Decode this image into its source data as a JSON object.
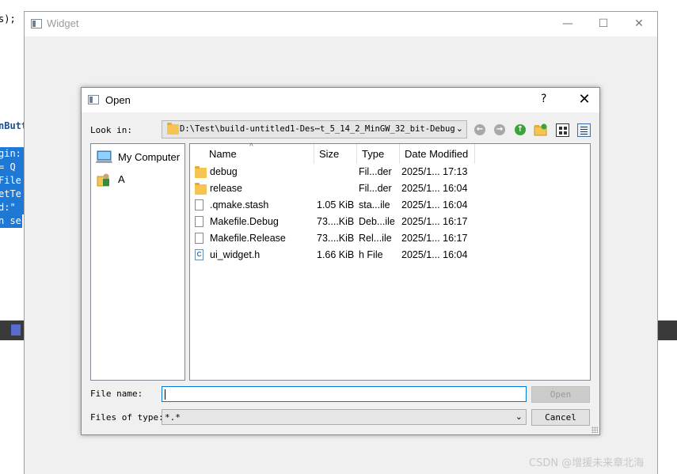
{
  "ide": {
    "lines": [
      "s);",
      "nButt",
      "gin:",
      " = Q",
      "File",
      "etTe",
      "d:\"",
      "n se"
    ]
  },
  "widget": {
    "title": "Widget",
    "minimize": "—",
    "maximize": "☐",
    "close": "✕"
  },
  "dialog": {
    "title": "Open",
    "help": "?",
    "close": "✕",
    "look_in_label": "Look in:",
    "look_in_path": "D:\\Test\\build-untitled1-Des⋯t_5_14_2_MinGW_32_bit-Debug",
    "sidebar": [
      {
        "label": "My Computer"
      },
      {
        "label": "A"
      }
    ],
    "columns": [
      "Name",
      "Size",
      "Type",
      "Date Modified"
    ],
    "files": [
      {
        "name": "debug",
        "size": "",
        "type": "Fil...der",
        "date": "2025/1... 17:13",
        "icon": "folder-icon"
      },
      {
        "name": "release",
        "size": "",
        "type": "Fil...der",
        "date": "2025/1... 16:04",
        "icon": "folder-icon"
      },
      {
        "name": ".qmake.stash",
        "size": "1.05 KiB",
        "type": "sta...ile",
        "date": "2025/1... 16:04",
        "icon": "file-icon"
      },
      {
        "name": "Makefile.Debug",
        "size": "73....KiB",
        "type": "Deb...ile",
        "date": "2025/1... 16:17",
        "icon": "file-icon"
      },
      {
        "name": "Makefile.Release",
        "size": "73....KiB",
        "type": "Rel...ile",
        "date": "2025/1... 16:17",
        "icon": "file-icon"
      },
      {
        "name": "ui_widget.h",
        "size": "1.66 KiB",
        "type": "h File",
        "date": "2025/1... 16:04",
        "icon": "c-header-icon"
      }
    ],
    "file_name_label": "File name:",
    "file_name_value": "",
    "open_button": "Open",
    "file_type_label": "Files of type:",
    "file_type_value": "*.*",
    "cancel_button": "Cancel"
  },
  "watermark": "CSDN @增援未来章北海"
}
